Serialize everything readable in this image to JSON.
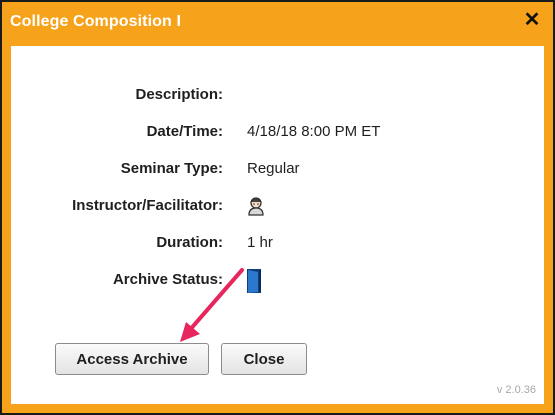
{
  "dialog": {
    "title": "College Composition I",
    "close_glyph": "✕"
  },
  "fields": {
    "description": {
      "label": "Description:",
      "value": ""
    },
    "datetime": {
      "label": "Date/Time:",
      "value": "4/18/18 8:00 PM ET"
    },
    "seminar_type": {
      "label": "Seminar Type:",
      "value": "Regular"
    },
    "instructor": {
      "label": "Instructor/Facilitator:",
      "icon": "person-icon"
    },
    "duration": {
      "label": "Duration:",
      "value": "1 hr"
    },
    "archive_status": {
      "label": "Archive Status:",
      "icon": "door-open-icon"
    }
  },
  "buttons": {
    "access_archive": "Access Archive",
    "close": "Close"
  },
  "version": "v 2.0.36",
  "colors": {
    "titlebar": "#f7a21b",
    "arrow": "#e8265e",
    "door": "#1f5fa8"
  }
}
